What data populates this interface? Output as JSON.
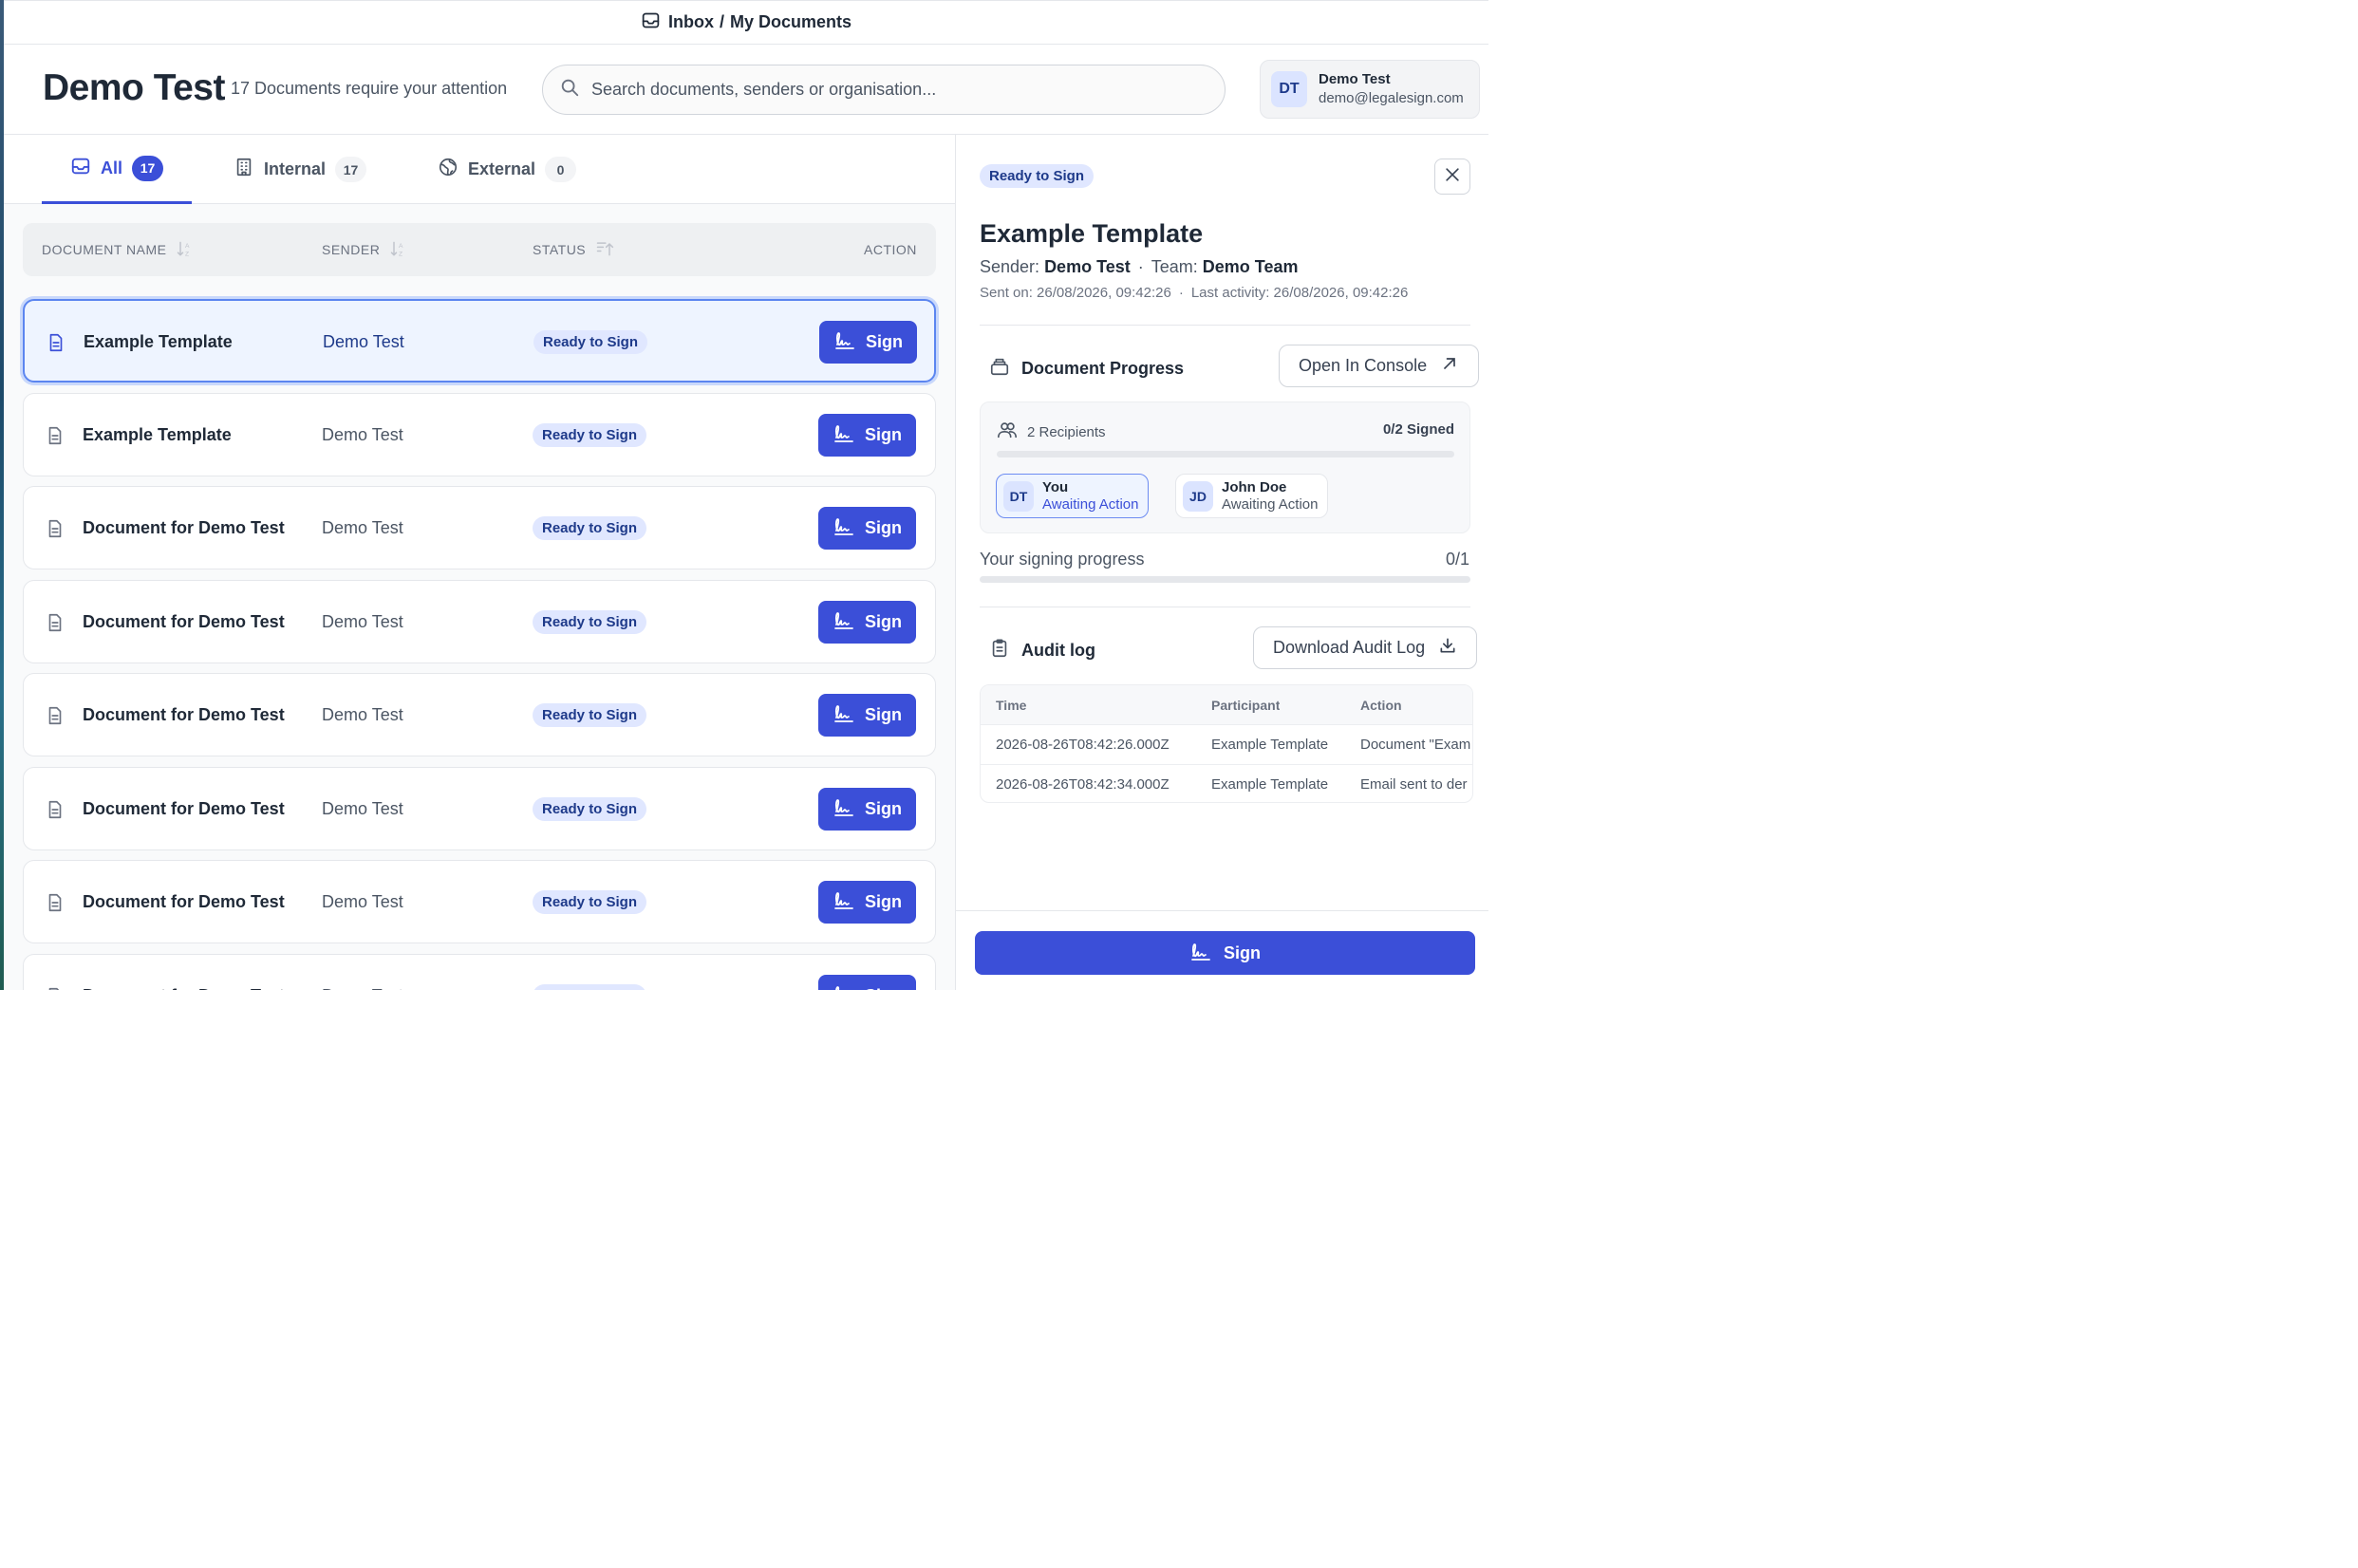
{
  "breadcrumb": {
    "root": "Inbox",
    "separator": "/",
    "current": "My Documents"
  },
  "header": {
    "title": "Demo Test",
    "subtitle": "17 Documents require your attention",
    "search_placeholder": "Search documents, senders or organisation...",
    "user": {
      "initials": "DT",
      "name": "Demo Test",
      "email": "demo@legalesign.com"
    }
  },
  "tabs": [
    {
      "label": "All",
      "count": "17",
      "icon": "inbox-icon",
      "active": true
    },
    {
      "label": "Internal",
      "count": "17",
      "icon": "building-icon",
      "active": false
    },
    {
      "label": "External",
      "count": "0",
      "icon": "globe-icon",
      "active": false
    }
  ],
  "table": {
    "headers": {
      "name": "DOCUMENT NAME",
      "sender": "SENDER",
      "status": "STATUS",
      "action": "ACTION"
    },
    "action_label": "Sign",
    "rows": [
      {
        "name": "Example Template",
        "sender": "Demo Test",
        "status": "Ready to Sign",
        "selected": true
      },
      {
        "name": "Example Template",
        "sender": "Demo Test",
        "status": "Ready to Sign"
      },
      {
        "name": "Document for Demo Test",
        "sender": "Demo Test",
        "status": "Ready to Sign"
      },
      {
        "name": "Document for Demo Test",
        "sender": "Demo Test",
        "status": "Ready to Sign"
      },
      {
        "name": "Document for Demo Test",
        "sender": "Demo Test",
        "status": "Ready to Sign"
      },
      {
        "name": "Document for Demo Test",
        "sender": "Demo Test",
        "status": "Ready to Sign"
      },
      {
        "name": "Document for Demo Test",
        "sender": "Demo Test",
        "status": "Ready to Sign"
      },
      {
        "name": "Document for Demo Test",
        "sender": "Demo Test",
        "status": "Ready to Sign"
      }
    ]
  },
  "detail": {
    "status": "Ready to Sign",
    "title": "Example Template",
    "sender_label": "Sender:",
    "sender": "Demo Test",
    "team_label": "Team:",
    "team": "Demo Team",
    "sent_on": "Sent on: 26/08/2026, 09:42:26",
    "last_activity": "Last activity: 26/08/2026, 09:42:26",
    "progress": {
      "heading": "Document Progress",
      "open_console": "Open In Console",
      "recipients_label": "2 Recipients",
      "signed_label": "0/2 Signed",
      "signed_fraction": 0,
      "recipients": [
        {
          "initials": "DT",
          "name": "You",
          "status": "Awaiting Action",
          "is_me": true
        },
        {
          "initials": "JD",
          "name": "John Doe",
          "status": "Awaiting Action",
          "is_me": false
        }
      ]
    },
    "signing_progress": {
      "label": "Your signing progress",
      "value": "0/1",
      "fraction": 0
    },
    "audit": {
      "heading": "Audit log",
      "download": "Download Audit Log",
      "columns": [
        "Time",
        "Participant",
        "Action"
      ],
      "rows": [
        [
          "2026-08-26T08:42:26.000Z",
          "Example Template",
          "Document \"Exam"
        ],
        [
          "2026-08-26T08:42:34.000Z",
          "Example Template",
          "Email sent to der"
        ]
      ]
    },
    "sign_button": "Sign"
  }
}
